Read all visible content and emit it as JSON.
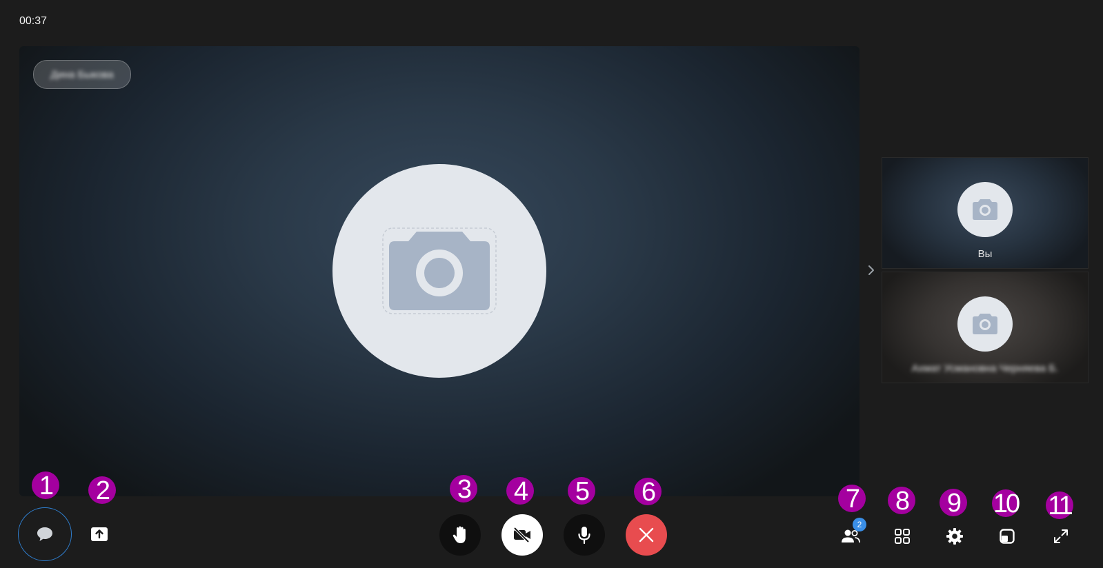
{
  "call": {
    "timer": "00:37",
    "main_participant_name": "Дина Быкова"
  },
  "thumbnails": [
    {
      "label": "Вы"
    },
    {
      "label": "Ахмат Усмановна Черняева Б."
    }
  ],
  "toolbar": {
    "participants_count": "2"
  },
  "markers": [
    "1",
    "2",
    "3",
    "4",
    "5",
    "6",
    "7",
    "8",
    "9",
    "10",
    "11"
  ],
  "icons": {
    "chat": "chat-bubble-icon",
    "share": "screen-share-icon",
    "hand": "raise-hand-icon",
    "video": "video-off-icon",
    "mic": "microphone-icon",
    "end": "close-icon",
    "participants": "participants-icon",
    "grid": "grid-layout-icon",
    "settings": "gear-icon",
    "pip": "picture-in-picture-icon",
    "fullscreen": "expand-icon",
    "camera": "camera-icon"
  },
  "colors": {
    "background": "#1c1c1c",
    "end_call": "#e84c4f",
    "accent_blue": "#3a8ee6",
    "marker": "#a4009f"
  }
}
